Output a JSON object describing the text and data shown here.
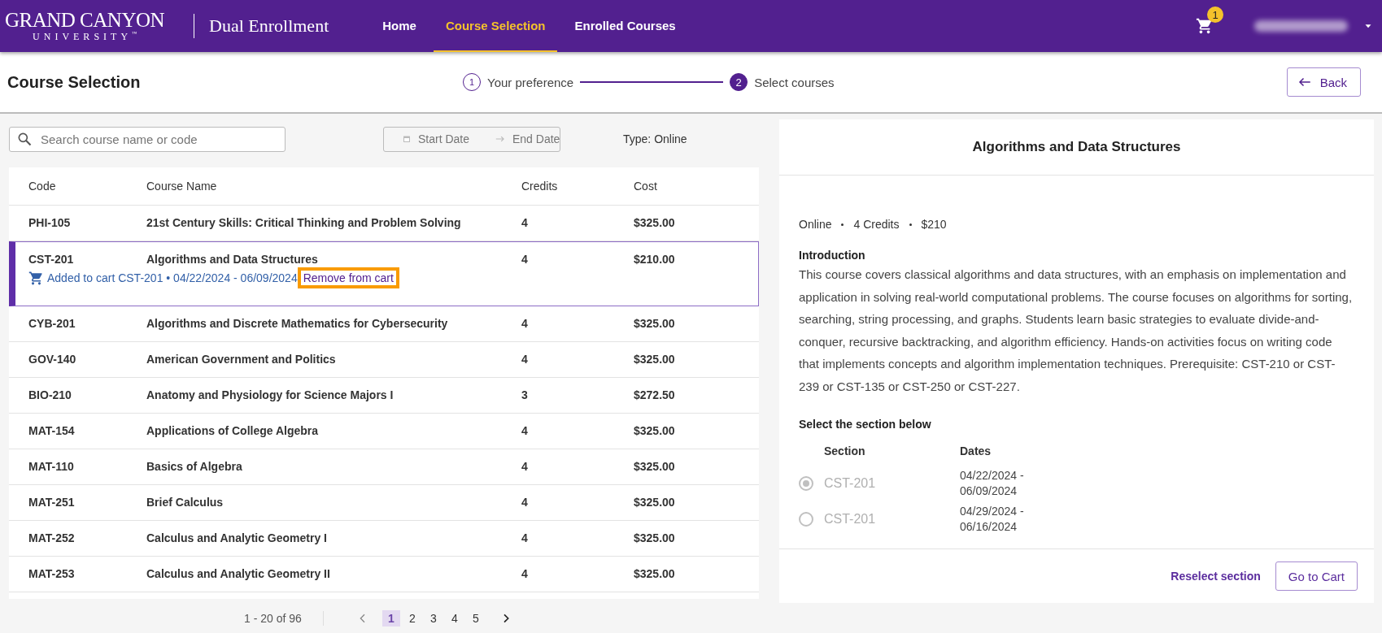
{
  "header": {
    "logo_line1": "GRAND CANYON",
    "logo_line2": "UNIVERSITY",
    "logo_tm": "™",
    "app_title": "Dual Enrollment",
    "nav": [
      {
        "label": "Home",
        "selected": false
      },
      {
        "label": "Course Selection",
        "selected": true
      },
      {
        "label": "Enrolled Courses",
        "selected": false
      }
    ],
    "cart_count": "1"
  },
  "page": {
    "title": "Course Selection",
    "steps": [
      {
        "number": "1",
        "label": "Your preference",
        "selected": false
      },
      {
        "number": "2",
        "label": "Select courses",
        "selected": true
      }
    ],
    "back_button": "Back"
  },
  "filters": {
    "search_placeholder": "Search course name or code",
    "start_placeholder": "Start Date",
    "end_placeholder": "End Date",
    "type": "Type: Online"
  },
  "table": {
    "columns": [
      "Code",
      "Course Name",
      "Credits",
      "Cost"
    ],
    "rows": [
      {
        "code": "PHI-105",
        "name": "21st Century Skills: Critical Thinking and Problem Solving",
        "credits": "4",
        "cost": "$325.00",
        "selected": false
      },
      {
        "code": "CST-201",
        "name": "Algorithms and Data Structures",
        "credits": "4",
        "cost": "$210.00",
        "selected": true,
        "cart": {
          "text": "Added to cart CST-201 • 04/22/2024 - 06/09/2024",
          "link": "Remove from cart",
          "highlighted": true
        }
      },
      {
        "code": "CYB-201",
        "name": "Algorithms and Discrete Mathematics for Cybersecurity",
        "credits": "4",
        "cost": "$325.00",
        "selected": false
      },
      {
        "code": "GOV-140",
        "name": "American Government and Politics",
        "credits": "4",
        "cost": "$325.00",
        "selected": false
      },
      {
        "code": "BIO-210",
        "name": "Anatomy and Physiology for Science Majors I",
        "credits": "3",
        "cost": "$272.50",
        "selected": false
      },
      {
        "code": "MAT-154",
        "name": "Applications of College Algebra",
        "credits": "4",
        "cost": "$325.00",
        "selected": false
      },
      {
        "code": "MAT-110",
        "name": "Basics of Algebra",
        "credits": "4",
        "cost": "$325.00",
        "selected": false
      },
      {
        "code": "MAT-251",
        "name": "Brief Calculus",
        "credits": "4",
        "cost": "$325.00",
        "selected": false
      },
      {
        "code": "MAT-252",
        "name": "Calculus and Analytic Geometry I",
        "credits": "4",
        "cost": "$325.00",
        "selected": false
      },
      {
        "code": "MAT-253",
        "name": "Calculus and Analytic Geometry II",
        "credits": "4",
        "cost": "$325.00",
        "selected": false
      }
    ]
  },
  "pagination": {
    "range": "1 - 20 of 96",
    "pages": [
      {
        "label": "1",
        "selected": true
      },
      {
        "label": "2",
        "selected": false
      },
      {
        "label": "3",
        "selected": false
      },
      {
        "label": "4",
        "selected": false
      },
      {
        "label": "5",
        "selected": false
      }
    ]
  },
  "detail": {
    "title": "Algorithms and Data Structures",
    "meta": [
      "Online",
      "4 Credits",
      "$210"
    ],
    "intro_heading": "Introduction",
    "intro": "This course covers classical algorithms and data structures, with an emphasis on implementation and application in solving real-world computational problems. The course focuses on algorithms for sorting, searching, string processing, and graphs. Students learn basic strategies to evaluate divide-and-conquer, recursive backtracking, and algorithm efficiency. Hands-on activities focus on writing code that implements concepts and algorithm implementation techniques. Prerequisite: CST-210 or CST-239 or CST-135 or CST-250 or CST-227.",
    "section_heading": "Select the section below",
    "section_columns": [
      "Section",
      "Dates"
    ],
    "sections": [
      {
        "code": "CST-201",
        "dates": "04/22/2024 - 06/09/2024",
        "selected": true,
        "disabled": true
      },
      {
        "code": "CST-201",
        "dates": "04/29/2024 - 06/16/2024",
        "selected": false,
        "disabled": true
      }
    ],
    "reselect": "Reselect section",
    "go_to_cart": "Go to Cart"
  }
}
